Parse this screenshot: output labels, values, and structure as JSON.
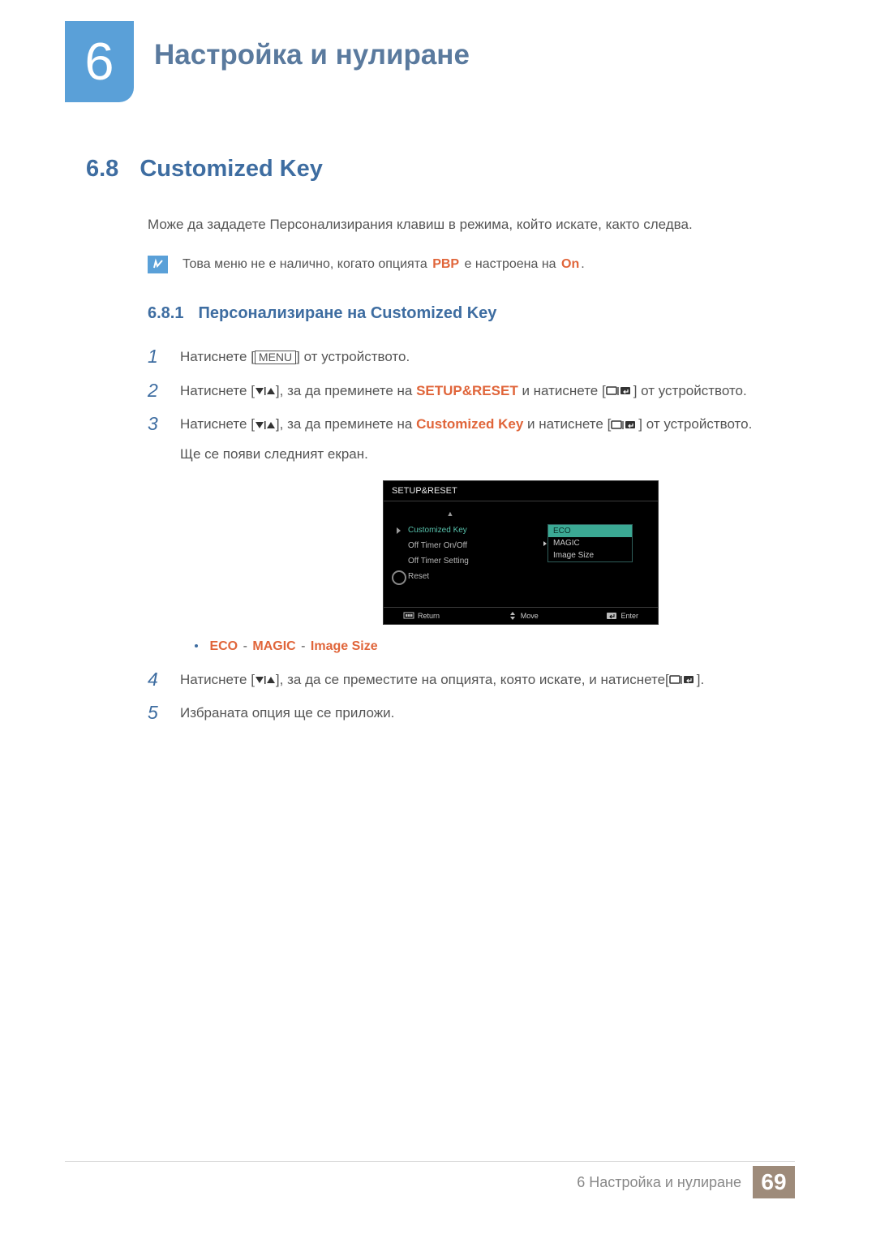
{
  "chapter": {
    "number": "6",
    "title": "Настройка и нулиране"
  },
  "section": {
    "number": "6.8",
    "title": "Customized Key",
    "intro": "Може да зададете Персонализирания клавиш в режима, който искате, както следва."
  },
  "note": {
    "prefix": "Това меню не е налично, когато опцията ",
    "pbp": "PBP",
    "mid": " е настроена на ",
    "on": "On",
    "suffix": "."
  },
  "subsection": {
    "number": "6.8.1",
    "title": "Персонализиране на Customized Key"
  },
  "steps": {
    "s1": {
      "num": "1",
      "prefix": "Натиснете [",
      "menu": "MENU",
      "suffix": "] от устройството."
    },
    "s2": {
      "num": "2",
      "p1": "Натиснете [",
      "p2": "], за да преминете на ",
      "target": "SETUP&RESET",
      "p3": " и натиснете [",
      "p4": "] от устройството."
    },
    "s3": {
      "num": "3",
      "p1": "Натиснете [",
      "p2": "], за да преминете на ",
      "target": "Customized Key",
      "p3": " и натиснете [",
      "p4": "] от устройството.",
      "line2": "Ще се появи следният екран."
    },
    "s4": {
      "num": "4",
      "p1": "Натиснете [",
      "p2": "], за да се преместите на опцията, която искате, и натиснете[",
      "p3": "]."
    },
    "s5": {
      "num": "5",
      "text": "Избраната опция ще се приложи."
    }
  },
  "osd": {
    "header": "SETUP&RESET",
    "items": {
      "i1": "Customized Key",
      "i2": "Off Timer On/Off",
      "i3": "Off Timer Setting",
      "i4": "Reset"
    },
    "dropdown": {
      "d1": "ECO",
      "d2": "MAGIC",
      "d3": "Image Size"
    },
    "footer": {
      "return": "Return",
      "move": "Move",
      "enter": "Enter"
    }
  },
  "bullet": {
    "eco": "ECO",
    "magic": "MAGIC",
    "image_size": "Image Size"
  },
  "footer": {
    "text": "6 Настройка и нулиране",
    "page": "69"
  }
}
